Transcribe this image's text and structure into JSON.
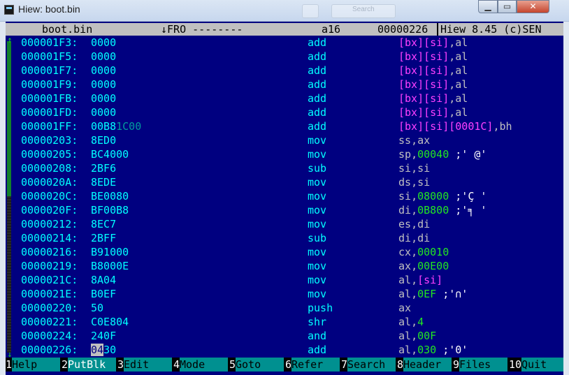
{
  "window": {
    "title": "Hiew: boot.bin",
    "search_ghost": "Search"
  },
  "status": {
    "filename": "boot.bin",
    "mode": "↓FRO --------",
    "bits": "a16",
    "offset": "00000226",
    "product": "Hiew 8.45 (c)SEN"
  },
  "rows": [
    {
      "addr": "000001F3:",
      "bytes": "0000",
      "mnemonic": "add",
      "ops": [
        {
          "t": "[bx][si]",
          "k": "mem"
        },
        {
          "t": ",",
          "k": "pun"
        },
        {
          "t": "al",
          "k": "reg"
        }
      ]
    },
    {
      "addr": "000001F5:",
      "bytes": "0000",
      "mnemonic": "add",
      "ops": [
        {
          "t": "[bx][si]",
          "k": "mem"
        },
        {
          "t": ",",
          "k": "pun"
        },
        {
          "t": "al",
          "k": "reg"
        }
      ]
    },
    {
      "addr": "000001F7:",
      "bytes": "0000",
      "mnemonic": "add",
      "ops": [
        {
          "t": "[bx][si]",
          "k": "mem"
        },
        {
          "t": ",",
          "k": "pun"
        },
        {
          "t": "al",
          "k": "reg"
        }
      ]
    },
    {
      "addr": "000001F9:",
      "bytes": "0000",
      "mnemonic": "add",
      "ops": [
        {
          "t": "[bx][si]",
          "k": "mem"
        },
        {
          "t": ",",
          "k": "pun"
        },
        {
          "t": "al",
          "k": "reg"
        }
      ]
    },
    {
      "addr": "000001FB:",
      "bytes": "0000",
      "mnemonic": "add",
      "ops": [
        {
          "t": "[bx][si]",
          "k": "mem"
        },
        {
          "t": ",",
          "k": "pun"
        },
        {
          "t": "al",
          "k": "reg"
        }
      ]
    },
    {
      "addr": "000001FD:",
      "bytes": "0000",
      "mnemonic": "add",
      "ops": [
        {
          "t": "[bx][si]",
          "k": "mem"
        },
        {
          "t": ",",
          "k": "pun"
        },
        {
          "t": "al",
          "k": "reg"
        }
      ]
    },
    {
      "addr": "000001FF:",
      "bytes": "00B8",
      "bytes_dim": "1C00",
      "mnemonic": "add",
      "ops": [
        {
          "t": "[bx][si][0001C]",
          "k": "mem"
        },
        {
          "t": ",",
          "k": "pun"
        },
        {
          "t": "bh",
          "k": "reg"
        }
      ]
    },
    {
      "addr": "00000203:",
      "bytes": "8ED0",
      "mnemonic": "mov",
      "ops": [
        {
          "t": "ss",
          "k": "reg"
        },
        {
          "t": ",",
          "k": "pun"
        },
        {
          "t": "ax",
          "k": "reg"
        }
      ]
    },
    {
      "addr": "00000205:",
      "bytes": "BC4000",
      "mnemonic": "mov",
      "ops": [
        {
          "t": "sp",
          "k": "reg"
        },
        {
          "t": ",",
          "k": "pun"
        },
        {
          "t": "00040",
          "k": "num"
        },
        {
          "t": " ;' @'",
          "k": "com"
        }
      ]
    },
    {
      "addr": "00000208:",
      "bytes": "2BF6",
      "mnemonic": "sub",
      "ops": [
        {
          "t": "si",
          "k": "reg"
        },
        {
          "t": ",",
          "k": "pun"
        },
        {
          "t": "si",
          "k": "reg"
        }
      ]
    },
    {
      "addr": "0000020A:",
      "bytes": "8EDE",
      "mnemonic": "mov",
      "ops": [
        {
          "t": "ds",
          "k": "reg"
        },
        {
          "t": ",",
          "k": "pun"
        },
        {
          "t": "si",
          "k": "reg"
        }
      ]
    },
    {
      "addr": "0000020C:",
      "bytes": "BE0080",
      "mnemonic": "mov",
      "ops": [
        {
          "t": "si",
          "k": "reg"
        },
        {
          "t": ",",
          "k": "pun"
        },
        {
          "t": "08000",
          "k": "num"
        },
        {
          "t": " ;'Ç '",
          "k": "com"
        }
      ]
    },
    {
      "addr": "0000020F:",
      "bytes": "BF00B8",
      "mnemonic": "mov",
      "ops": [
        {
          "t": "di",
          "k": "reg"
        },
        {
          "t": ",",
          "k": "pun"
        },
        {
          "t": "0B800",
          "k": "num"
        },
        {
          "t": " ;'╕ '",
          "k": "com"
        }
      ]
    },
    {
      "addr": "00000212:",
      "bytes": "8EC7",
      "mnemonic": "mov",
      "ops": [
        {
          "t": "es",
          "k": "reg"
        },
        {
          "t": ",",
          "k": "pun"
        },
        {
          "t": "di",
          "k": "reg"
        }
      ]
    },
    {
      "addr": "00000214:",
      "bytes": "2BFF",
      "mnemonic": "sub",
      "ops": [
        {
          "t": "di",
          "k": "reg"
        },
        {
          "t": ",",
          "k": "pun"
        },
        {
          "t": "di",
          "k": "reg"
        }
      ]
    },
    {
      "addr": "00000216:",
      "bytes": "B91000",
      "mnemonic": "mov",
      "ops": [
        {
          "t": "cx",
          "k": "reg"
        },
        {
          "t": ",",
          "k": "pun"
        },
        {
          "t": "00010",
          "k": "num"
        }
      ]
    },
    {
      "addr": "00000219:",
      "bytes": "B8000E",
      "mnemonic": "mov",
      "ops": [
        {
          "t": "ax",
          "k": "reg"
        },
        {
          "t": ",",
          "k": "pun"
        },
        {
          "t": "00E00",
          "k": "num"
        }
      ]
    },
    {
      "addr": "0000021C:",
      "bytes": "8A04",
      "mnemonic": "mov",
      "ops": [
        {
          "t": "al",
          "k": "reg"
        },
        {
          "t": ",",
          "k": "pun"
        },
        {
          "t": "[si]",
          "k": "mem"
        }
      ]
    },
    {
      "addr": "0000021E:",
      "bytes": "B0EF",
      "mnemonic": "mov",
      "ops": [
        {
          "t": "al",
          "k": "reg"
        },
        {
          "t": ",",
          "k": "pun"
        },
        {
          "t": "0EF",
          "k": "num"
        },
        {
          "t": " ;'∩'",
          "k": "com"
        }
      ]
    },
    {
      "addr": "00000220:",
      "bytes": "50",
      "mnemonic": "push",
      "ops": [
        {
          "t": "ax",
          "k": "reg"
        }
      ]
    },
    {
      "addr": "00000221:",
      "bytes": "C0E804",
      "mnemonic": "shr",
      "ops": [
        {
          "t": "al",
          "k": "reg"
        },
        {
          "t": ",",
          "k": "pun"
        },
        {
          "t": "4",
          "k": "num"
        }
      ]
    },
    {
      "addr": "00000224:",
      "bytes": "240F",
      "mnemonic": "and",
      "ops": [
        {
          "t": "al",
          "k": "reg"
        },
        {
          "t": ",",
          "k": "pun"
        },
        {
          "t": "00F",
          "k": "num"
        }
      ]
    },
    {
      "addr": "00000226:",
      "bytes_cursor": "04",
      "bytes_rest": "30",
      "mnemonic": "add",
      "ops": [
        {
          "t": "al",
          "k": "reg"
        },
        {
          "t": ",",
          "k": "pun"
        },
        {
          "t": "030",
          "k": "num"
        },
        {
          "t": " ;'0'",
          "k": "com"
        }
      ]
    }
  ],
  "fkeys": [
    {
      "num": "1",
      "label": "Help",
      "hi": false
    },
    {
      "num": "2",
      "label": "PutBlk",
      "hi": true
    },
    {
      "num": "3",
      "label": "Edit",
      "hi": false
    },
    {
      "num": "4",
      "label": "Mode",
      "hi": false
    },
    {
      "num": "5",
      "label": "Goto",
      "hi": false
    },
    {
      "num": "6",
      "label": "Refer",
      "hi": false
    },
    {
      "num": "7",
      "label": "Search",
      "hi": false
    },
    {
      "num": "8",
      "label": "Header",
      "hi": false
    },
    {
      "num": "9",
      "label": "Files",
      "hi": false
    },
    {
      "num": "10",
      "label": "Quit",
      "hi": false
    }
  ],
  "colors": {
    "background": "#000080",
    "address": "#00ffff",
    "memory_operand": "#ff40ff",
    "immediate": "#22e622",
    "fkey_label_bg": "#009090"
  }
}
